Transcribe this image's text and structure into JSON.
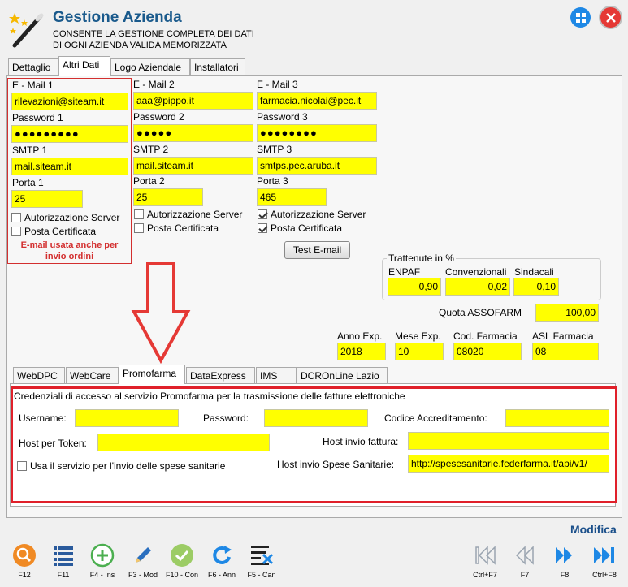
{
  "header": {
    "title": "Gestione Azienda",
    "subtitle1": "CONSENTE LA GESTIONE COMPLETA DEI DATI",
    "subtitle2": "DI OGNI AZIENDA VALIDA MEMORIZZATA"
  },
  "tabs": [
    "Dettaglio",
    "Altri Dati",
    "Logo Aziendale",
    "Installatori"
  ],
  "email_blocks": [
    {
      "email_label": "E - Mail 1",
      "email": "rilevazioni@siteam.it",
      "password_label": "Password 1",
      "password": "●●●●●●●●●",
      "smtp_label": "SMTP 1",
      "smtp": "mail.siteam.it",
      "port_label": "Porta 1",
      "port": "25",
      "auth_label": "Autorizzazione Server",
      "auth": false,
      "cert_label": "Posta Certificata",
      "cert": false
    },
    {
      "email_label": "E - Mail 2",
      "email": "aaa@pippo.it",
      "password_label": "Password 2",
      "password": "●●●●●",
      "smtp_label": "SMTP 2",
      "smtp": "mail.siteam.it",
      "port_label": "Porta 2",
      "port": "25",
      "auth_label": "Autorizzazione Server",
      "auth": false,
      "cert_label": "Posta Certificata",
      "cert": false
    },
    {
      "email_label": "E - Mail 3",
      "email": "farmacia.nicolai@pec.it",
      "password_label": "Password 3",
      "password": "●●●●●●●●",
      "smtp_label": "SMTP 3",
      "smtp": "smtps.pec.aruba.it",
      "port_label": "Porta 3",
      "port": "465",
      "auth_label": "Autorizzazione Server",
      "auth": true,
      "cert_label": "Posta Certificata",
      "cert": true
    }
  ],
  "email_note_line1": "E-mail usata anche per",
  "email_note_line2": "invio ordini",
  "test_email_button": "Test E-mail",
  "trattenute": {
    "title": "Trattenute in %",
    "enpaf_label": "ENPAF",
    "enpaf": "0,90",
    "conv_label": "Convenzionali",
    "conv": "0,02",
    "sind_label": "Sindacali",
    "sind": "0,10"
  },
  "quota_label": "Quota ASSOFARM",
  "quota": "100,00",
  "exp": {
    "anno_label": "Anno Exp.",
    "anno": "2018",
    "mese_label": "Mese Exp.",
    "mese": "10",
    "cod_label": "Cod. Farmacia",
    "cod": "08020",
    "asl_label": "ASL Farmacia",
    "asl": "08"
  },
  "subtabs": [
    "WebDPC",
    "WebCare",
    "Promofarma",
    "DataExpress",
    "IMS",
    "DCROnLine Lazio"
  ],
  "promofarma": {
    "description": "Credenziali di accesso al servizio Promofarma per la trasmissione delle fatture elettroniche",
    "username_label": "Username:",
    "username": "",
    "password_label": "Password:",
    "password": "",
    "codice_label": "Codice Accreditamento:",
    "codice": "",
    "host_token_label": "Host per Token:",
    "host_token": "",
    "host_fattura_label": "Host invio fattura:",
    "host_fattura": "",
    "usa_servizio_label": "Usa il servizio  per l'invio delle spese sanitarie",
    "host_spese_label": "Host invio Spese Sanitarie:",
    "host_spese": "http://spesesanitarie.federfarma.it/api/v1/"
  },
  "status": "Modifica",
  "toolbar": [
    {
      "label": "F12",
      "icon": "search-icon"
    },
    {
      "label": "F11",
      "icon": "list-icon"
    },
    {
      "label": "F4 - Ins",
      "icon": "plus-icon"
    },
    {
      "label": "F3 - Mod",
      "icon": "pencil-icon"
    },
    {
      "label": "F10 - Con",
      "icon": "check-icon"
    },
    {
      "label": "F6 - Ann",
      "icon": "undo-icon"
    },
    {
      "label": "F5 - Can",
      "icon": "delete-icon"
    }
  ],
  "nav": [
    {
      "label": "Ctrl+F7",
      "icon": "first-icon"
    },
    {
      "label": "F7",
      "icon": "prev-icon"
    },
    {
      "label": "F8",
      "icon": "next-icon"
    },
    {
      "label": "Ctrl+F8",
      "icon": "last-icon"
    }
  ],
  "colors": {
    "accent": "#1a5a8c",
    "field": "#ffff00",
    "highlight": "#e0202a",
    "nav_active": "#1e88e5"
  }
}
